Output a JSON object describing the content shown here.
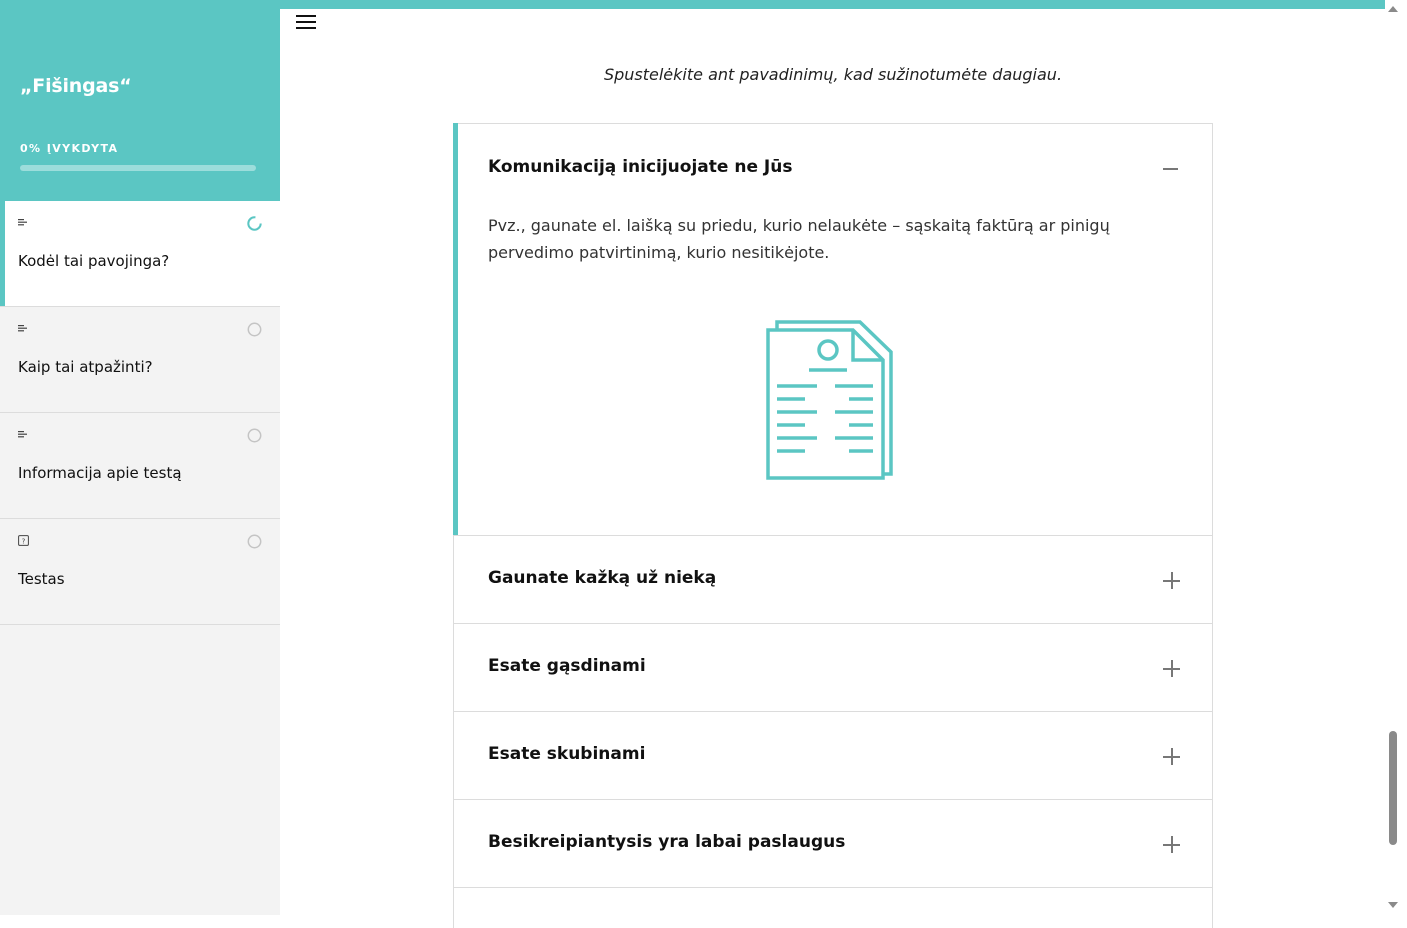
{
  "sidebar": {
    "course_title": "„Fišingas“",
    "progress_label": "0% ĮVYKDYTA",
    "progress_value": 0,
    "items": [
      {
        "label": "Kodėl tai pavojinga?",
        "type_icon": "lines-icon",
        "status_icon": "in-progress-icon",
        "active": true
      },
      {
        "label": "Kaip tai atpažinti?",
        "type_icon": "lines-icon",
        "status_icon": "empty-circle-icon",
        "active": false
      },
      {
        "label": "Informacija apie testą",
        "type_icon": "lines-icon",
        "status_icon": "empty-circle-icon",
        "active": false
      },
      {
        "label": "Testas",
        "type_icon": "quiz-icon",
        "status_icon": "empty-circle-icon",
        "active": false
      }
    ]
  },
  "main": {
    "instruction": "Spustelėkite ant pavadinimų, kad sužinotumėte daugiau.",
    "accordion": {
      "open_item": {
        "title": "Komunikaciją inicijuojate ne Jūs",
        "body": "Pvz., gaunate el. laišką su priedu, kurio nelaukėte – sąskaitą faktūrą ar pinigų pervedimo patvirtinimą, kurio nesitikėjote.",
        "illustration": "document-icon"
      },
      "closed_items": [
        {
          "title": "Gaunate kažką už nieką"
        },
        {
          "title": "Esate gąsdinami"
        },
        {
          "title": "Esate skubinami"
        },
        {
          "title": "Besikreipiantysis yra labai paslaugus"
        }
      ]
    }
  },
  "colors": {
    "accent": "#5bc6c3",
    "sidebar_bg": "#f3f3f3",
    "border": "#dcdcdc"
  }
}
